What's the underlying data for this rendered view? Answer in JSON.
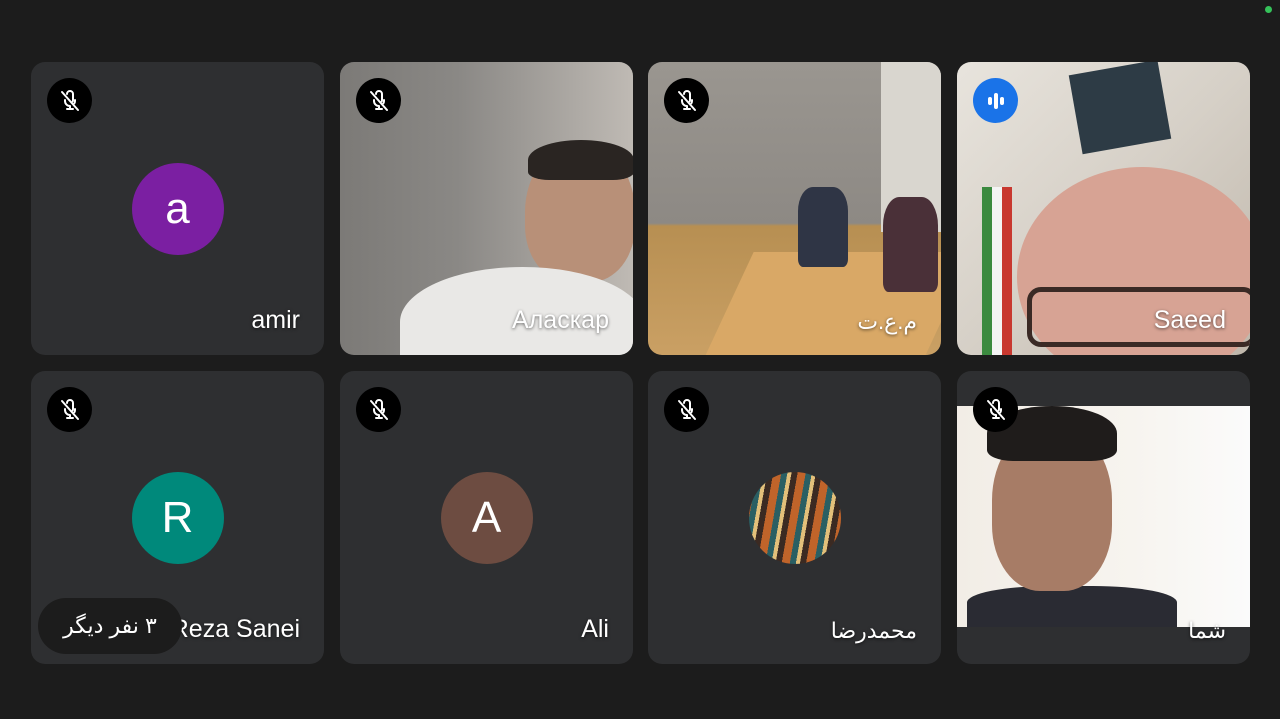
{
  "participants": [
    {
      "name": "amir",
      "avatar_letter": "a",
      "avatar_color": "#7b1fa2",
      "mic": "muted"
    },
    {
      "name": "Аласкар",
      "mic": "muted",
      "video": true
    },
    {
      "name": "م.ع.ت",
      "mic": "muted",
      "video": true
    },
    {
      "name": "Saeed",
      "mic": "speaking",
      "video": true
    },
    {
      "name": "Reza Sanei",
      "avatar_letter": "R",
      "avatar_color": "#00897b",
      "mic": "muted"
    },
    {
      "name": "Ali",
      "avatar_letter": "A",
      "avatar_color": "#6d4c41",
      "mic": "muted"
    },
    {
      "name": "محمدرضا",
      "mic": "muted",
      "avatar_image": true
    },
    {
      "name": "شما",
      "mic": "muted",
      "video": true
    }
  ],
  "more_participants": "۳ نفر دیگر",
  "colors": {
    "background": "#1c1c1c",
    "tile": "#2e2f31",
    "speaking": "#1a73e8",
    "online_dot": "#35c25a"
  },
  "icons": {
    "muted": "mic-off-icon",
    "speaking": "audio-level-icon"
  }
}
